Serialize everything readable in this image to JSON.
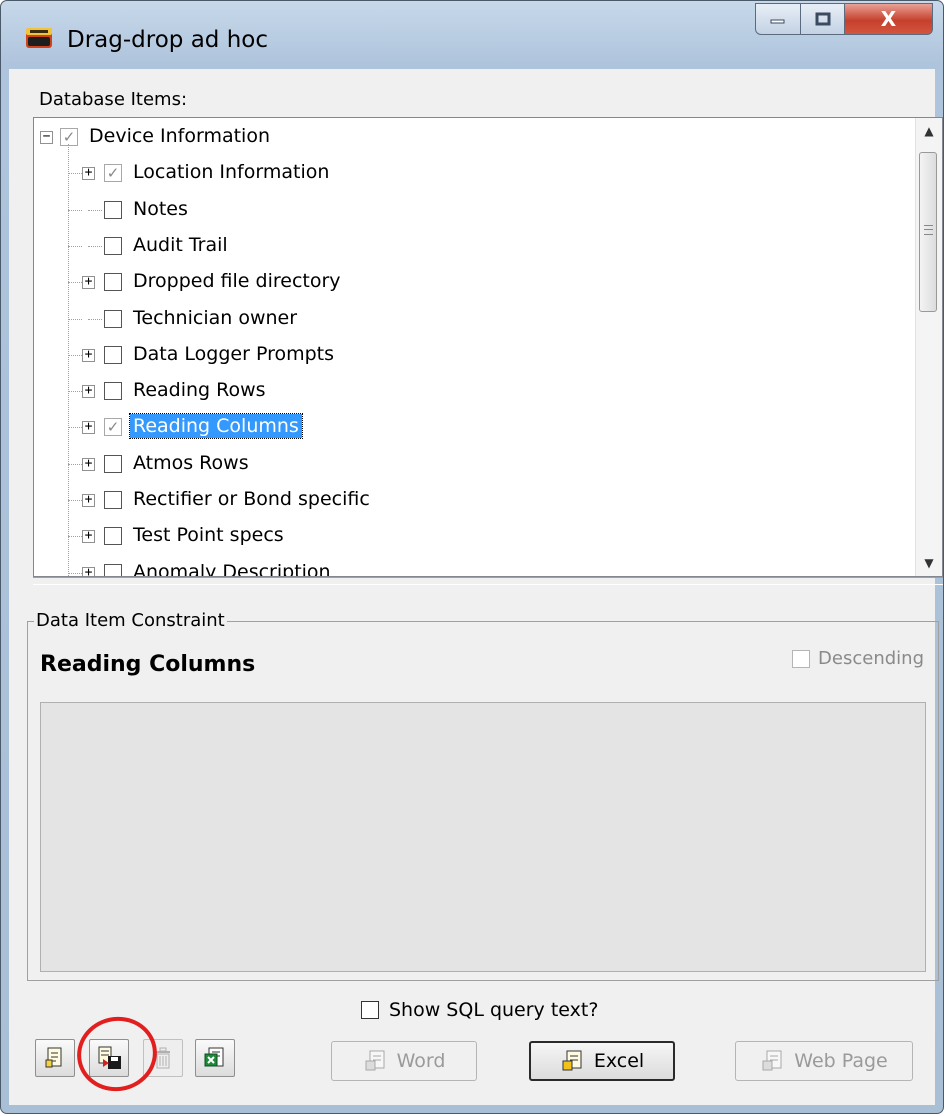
{
  "window": {
    "title": "Drag-drop ad hoc",
    "controls": {
      "minimize": "—",
      "maximize": "□",
      "close": "X"
    }
  },
  "database_items": {
    "label": "Database Items:",
    "tree": [
      {
        "label": "Device Information",
        "expander": "minus",
        "checked": true,
        "disabled": true,
        "selected": false
      },
      {
        "label": "Location Information",
        "expander": "plus",
        "checked": true,
        "disabled": true,
        "selected": false
      },
      {
        "label": "Notes",
        "expander": "none",
        "checked": false,
        "disabled": false,
        "selected": false
      },
      {
        "label": "Audit Trail",
        "expander": "none",
        "checked": false,
        "disabled": false,
        "selected": false
      },
      {
        "label": "Dropped file directory",
        "expander": "plus",
        "checked": false,
        "disabled": false,
        "selected": false
      },
      {
        "label": "Technician owner",
        "expander": "none",
        "checked": false,
        "disabled": false,
        "selected": false
      },
      {
        "label": "Data Logger Prompts",
        "expander": "plus",
        "checked": false,
        "disabled": false,
        "selected": false
      },
      {
        "label": "Reading Rows",
        "expander": "plus",
        "checked": false,
        "disabled": false,
        "selected": false
      },
      {
        "label": "Reading Columns",
        "expander": "plus",
        "checked": true,
        "disabled": true,
        "selected": true
      },
      {
        "label": "Atmos Rows",
        "expander": "plus",
        "checked": false,
        "disabled": false,
        "selected": false
      },
      {
        "label": "Rectifier or Bond specific",
        "expander": "plus",
        "checked": false,
        "disabled": false,
        "selected": false
      },
      {
        "label": "Test Point specs",
        "expander": "plus",
        "checked": false,
        "disabled": false,
        "selected": false
      },
      {
        "label": "Anomaly Description",
        "expander": "plus",
        "checked": false,
        "disabled": false,
        "selected": false
      }
    ]
  },
  "constraint": {
    "legend": "Data Item Constraint",
    "title": "Reading Columns",
    "descending_label": "Descending",
    "descending_checked": false
  },
  "show_sql": {
    "label": "Show SQL query text?",
    "checked": false
  },
  "toolbar": {
    "icons": [
      "new-report-icon",
      "save-report-icon",
      "delete-icon",
      "excel-export-icon"
    ]
  },
  "buttons": {
    "word": "Word",
    "excel": "Excel",
    "web": "Web Page"
  },
  "colors": {
    "selection": "#3399ff",
    "annotation_circle": "#e21f1f"
  }
}
